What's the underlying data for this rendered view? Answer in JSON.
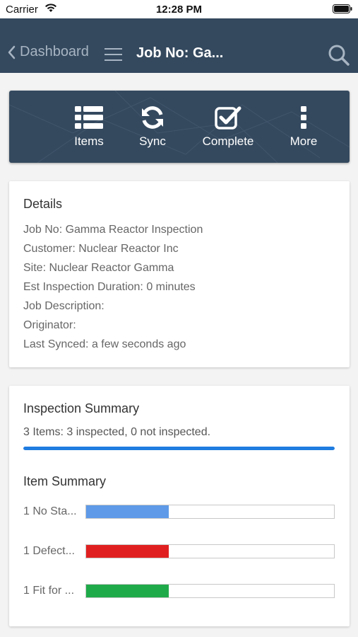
{
  "status": {
    "carrier": "Carrier",
    "time": "12:28 PM"
  },
  "nav": {
    "back_label": "Dashboard",
    "title": "Job No: Ga..."
  },
  "toolbar": {
    "items_label": "Items",
    "sync_label": "Sync",
    "complete_label": "Complete",
    "more_label": "More"
  },
  "details": {
    "heading": "Details",
    "job_no": "Job No: Gamma Reactor Inspection",
    "customer": "Customer: Nuclear Reactor Inc",
    "site": "Site: Nuclear Reactor Gamma",
    "duration": "Est Inspection Duration: 0 minutes",
    "description": "Job Description:",
    "originator": "Originator:",
    "last_synced": "Last Synced: a few seconds ago"
  },
  "inspection_summary": {
    "heading": "Inspection Summary",
    "text": "3 Items: 3 inspected, 0 not inspected.",
    "progress_percent": 100
  },
  "item_summary": {
    "heading": "Item Summary",
    "rows": [
      {
        "label": "1 No Sta...",
        "fraction": 0.333,
        "color": "#5e9ae8"
      },
      {
        "label": "1 Defect...",
        "fraction": 0.333,
        "color": "#e02020"
      },
      {
        "label": "1 Fit for ...",
        "fraction": 0.333,
        "color": "#1faa4a"
      }
    ]
  },
  "colors": {
    "nav": "#34495e",
    "accent": "#1f7ce0"
  }
}
